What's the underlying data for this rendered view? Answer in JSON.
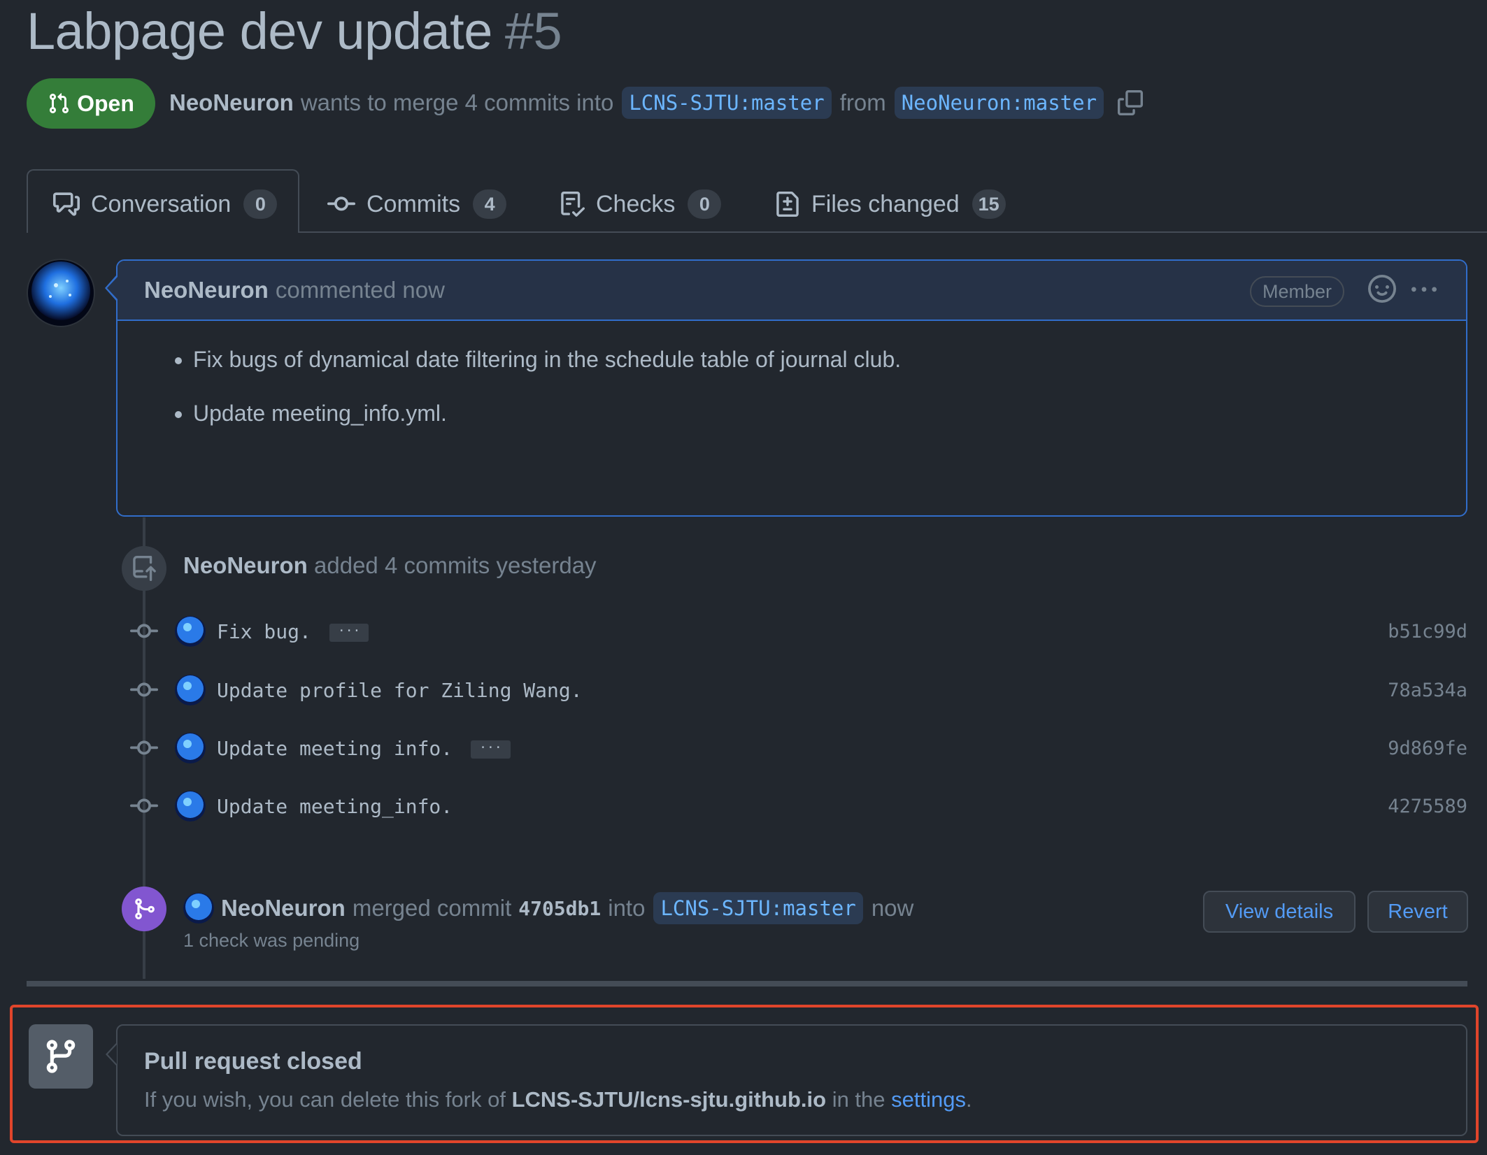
{
  "header": {
    "title": "Labpage dev update",
    "number": "#5",
    "status": "Open",
    "author": "NeoNeuron",
    "merge_text": "wants to merge 4 commits into",
    "base_branch": "LCNS-SJTU:master",
    "from_text": "from",
    "head_branch": "NeoNeuron:master"
  },
  "tabs": [
    {
      "label": "Conversation",
      "count": "0",
      "icon": "comment-discussion-icon"
    },
    {
      "label": "Commits",
      "count": "4",
      "icon": "git-commit-icon"
    },
    {
      "label": "Checks",
      "count": "0",
      "icon": "checklist-icon"
    },
    {
      "label": "Files changed",
      "count": "15",
      "icon": "file-diff-icon"
    }
  ],
  "comment": {
    "author": "NeoNeuron",
    "action": "commented now",
    "badge": "Member",
    "items": [
      "Fix bugs of dynamical date filtering in the schedule table of journal club.",
      "Update meeting_info.yml."
    ]
  },
  "commits_event": {
    "author": "NeoNeuron",
    "text": "added 4 commits yesterday"
  },
  "commits": [
    {
      "message": "Fix bug.",
      "sha": "b51c99d",
      "has_more": true
    },
    {
      "message": "Update profile for Ziling Wang.",
      "sha": "78a534a",
      "has_more": false
    },
    {
      "message": "Update meeting info.",
      "sha": "9d869fe",
      "has_more": true
    },
    {
      "message": "Update meeting_info.",
      "sha": "4275589",
      "has_more": false
    }
  ],
  "merge_event": {
    "author": "NeoNeuron",
    "text": "merged commit",
    "sha": "4705db1",
    "into": "into",
    "branch": "LCNS-SJTU:master",
    "when": "now",
    "checks": "1 check was pending",
    "view_details": "View details",
    "revert": "Revert"
  },
  "closed": {
    "title": "Pull request closed",
    "desc_prefix": "If you wish, you can delete this fork of",
    "repo": "LCNS-SJTU/lcns-sjtu.github.io",
    "desc_mid": "in the",
    "settings_link": "settings",
    "desc_end": "."
  },
  "colors": {
    "background": "#22272e",
    "open_green": "#347d39",
    "merged_purple": "#8256d0",
    "link_blue": "#539bf5",
    "highlight_red": "#e0452b"
  }
}
